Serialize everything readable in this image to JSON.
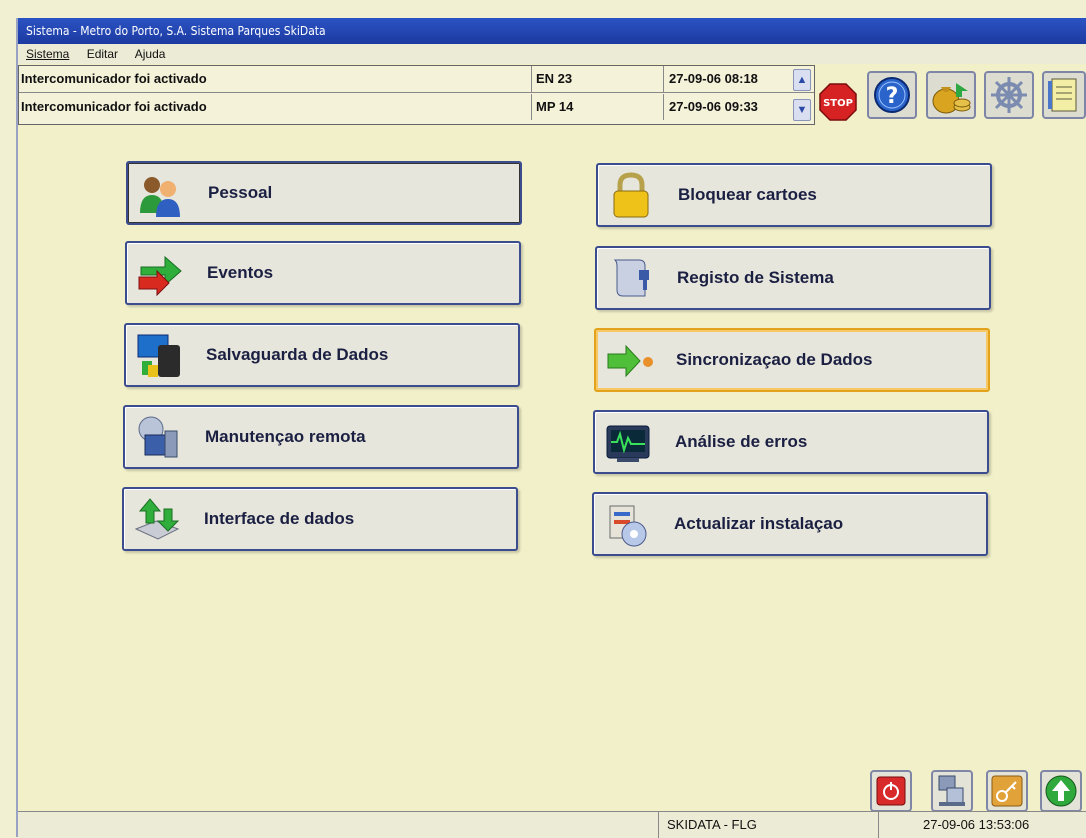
{
  "window": {
    "title": "Sistema - Metro do Porto, S.A.  Sistema Parques SkiData"
  },
  "menu": [
    "Sistema",
    "Editar",
    "Ajuda"
  ],
  "alerts": [
    {
      "message": "Intercomunicador foi activado",
      "code": "EN 23",
      "time": "27-09-06 08:18"
    },
    {
      "message": "Intercomunicador foi activado",
      "code": "MP 14",
      "time": "27-09-06 09:33"
    }
  ],
  "toolbar": {
    "stop_label": "STOP",
    "help_label": "?"
  },
  "buttons_left": [
    {
      "label": "Pessoal",
      "icon": "people-icon"
    },
    {
      "label": "Eventos",
      "icon": "arrow-events-icon"
    },
    {
      "label": "Salvaguarda de Dados",
      "icon": "backup-icon"
    },
    {
      "label": "Manutençao remota",
      "icon": "remote-maintenance-icon"
    },
    {
      "label": "Interface de dados",
      "icon": "data-interface-icon"
    }
  ],
  "buttons_right": [
    {
      "label": "Bloquear cartoes",
      "icon": "padlock-icon"
    },
    {
      "label": "Registo de Sistema",
      "icon": "scroll-log-icon"
    },
    {
      "label": "Sincronizaçao de Dados",
      "icon": "sync-arrow-icon"
    },
    {
      "label": "Análise de erros",
      "icon": "monitor-analysis-icon"
    },
    {
      "label": "Actualizar instalaçao",
      "icon": "install-update-icon"
    }
  ],
  "status": {
    "system": "SKIDATA - FLG",
    "datetime": "27-09-06 13:53:06"
  },
  "colors": {
    "background": "#f1f0c9",
    "titlebar": "#2b53c4",
    "button_border": "#3b4d8e",
    "focus_border": "#e2a21b"
  }
}
